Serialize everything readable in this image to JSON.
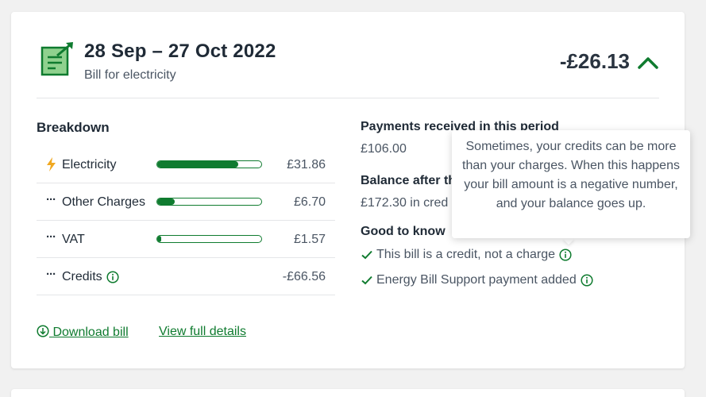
{
  "bill": {
    "period": "28 Sep – 27 Oct 2022",
    "subtitle": "Bill for electricity",
    "amount": "-£26.13"
  },
  "breakdown": {
    "title": "Breakdown",
    "rows": [
      {
        "label": "Electricity",
        "value": "£31.86",
        "bar_fraction": 0.78,
        "icon": "lightning-icon"
      },
      {
        "label": "Other Charges",
        "value": "£6.70",
        "bar_fraction": 0.17,
        "icon": "more-dots-icon"
      },
      {
        "label": "VAT",
        "value": "£1.57",
        "bar_fraction": 0.04,
        "icon": "more-dots-icon"
      },
      {
        "label": "Credits",
        "value": "-£66.56",
        "icon": "more-dots-icon",
        "info": true
      }
    ]
  },
  "payments": {
    "title": "Payments received in this period",
    "value": "£106.00"
  },
  "balance": {
    "title": "Balance after th",
    "value": "£172.30 in cred"
  },
  "good_to_know": {
    "title": "Good to know",
    "items": [
      "This bill is a credit, not a charge",
      "Energy Bill Support payment added"
    ]
  },
  "tooltip": {
    "text": "Sometimes, your credits can be more than your charges. When this happens your bill amount is a negative number, and your balance goes up."
  },
  "links": {
    "download": "Download bill",
    "full_details": "View full details"
  },
  "colors": {
    "accent": "#0f7b2f",
    "text_dark": "#1f2a36",
    "text_muted": "#4a5563",
    "lightning": "#f0a820"
  }
}
